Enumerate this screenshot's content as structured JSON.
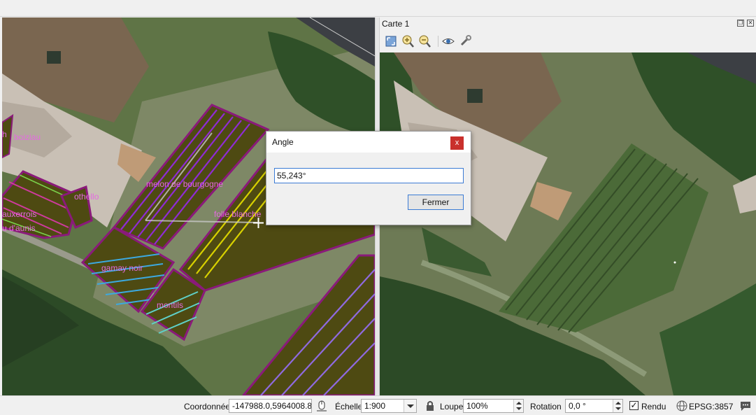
{
  "map_labels": {
    "boiziau": "boiziau",
    "melon": "melon de bourgogne",
    "folle": "folle blanche",
    "othello": "othello",
    "auxerrois": "auxerrois",
    "aunis": "u d'aunis",
    "h": "h",
    "gamay": "gamay noir",
    "montils": "montils"
  },
  "map_panel": {
    "title": "Carte 1",
    "tools": [
      "zoom-full-icon",
      "zoom-in-icon",
      "zoom-out-icon",
      "view-icon",
      "settings-wrench-icon"
    ]
  },
  "dialog": {
    "title": "Angle",
    "value": "55,243°",
    "close_button": "Fermer",
    "close_x": "x"
  },
  "statusbar": {
    "coord_label": "Coordonnée",
    "coord_value": "-147988.0,5964008.8",
    "scale_label": "Échelle",
    "scale_value": "1:900",
    "magnifier_label": "Loupe",
    "magnifier_value": "100%",
    "rotation_label": "Rotation",
    "rotation_value": "0,0 °",
    "render_label": "Rendu",
    "render_checked": true,
    "crs_label": "EPSG:3857"
  },
  "colors": {
    "label": "#e46ae0",
    "parcel_outline": "#8a1a7a",
    "dialog_close": "#c9302c",
    "accent": "#3b7bd4"
  }
}
